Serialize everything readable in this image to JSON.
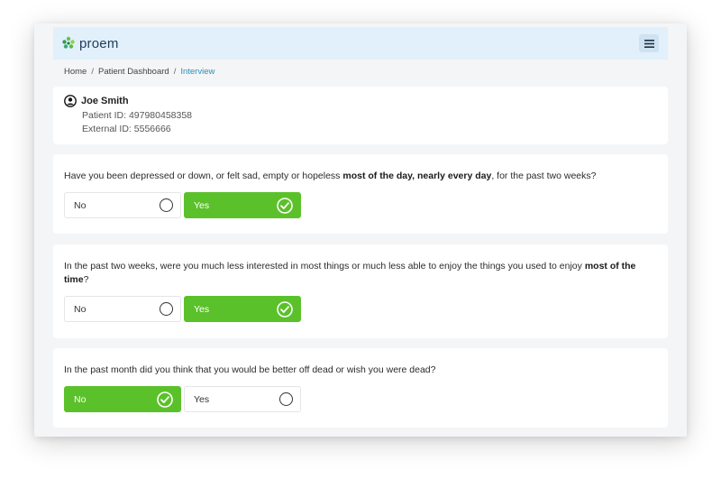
{
  "app": {
    "name": "proem"
  },
  "breadcrumb": [
    "Home",
    "Patient Dashboard",
    "Interview"
  ],
  "patient": {
    "name": "Joe Smith",
    "patient_id": "Patient ID: 497980458358",
    "external_id": "External ID: 5556666"
  },
  "questions": [
    {
      "before": "Have you been depressed or down, or felt sad, empty or hopeless ",
      "bold": "most of the day, nearly every day",
      "after": ", for the past two weeks?",
      "options": [
        {
          "label": "No",
          "selected": false
        },
        {
          "label": "Yes",
          "selected": true
        }
      ]
    },
    {
      "before": "In the past two weeks, were you much less interested in most things or much less able to enjoy the things you used to enjoy ",
      "bold": "most of the time",
      "after": "?",
      "options": [
        {
          "label": "No",
          "selected": false
        },
        {
          "label": "Yes",
          "selected": true
        }
      ]
    },
    {
      "before": "In the past month did you think that you would be better off dead or wish you were dead?",
      "bold": "",
      "after": "",
      "options": [
        {
          "label": "No",
          "selected": true
        },
        {
          "label": "Yes",
          "selected": false
        }
      ]
    }
  ],
  "icons": {
    "logo": "leaf-cluster-icon",
    "menu": "hamburger-menu-icon",
    "person": "user-circle-icon",
    "selected": "check-circle-icon",
    "unselected": "radio-empty-icon"
  },
  "colors": {
    "accent_green": "#5bc12a",
    "topbar_bg": "#e1f0fb",
    "breadcrumb_active": "#2b8fb5"
  }
}
